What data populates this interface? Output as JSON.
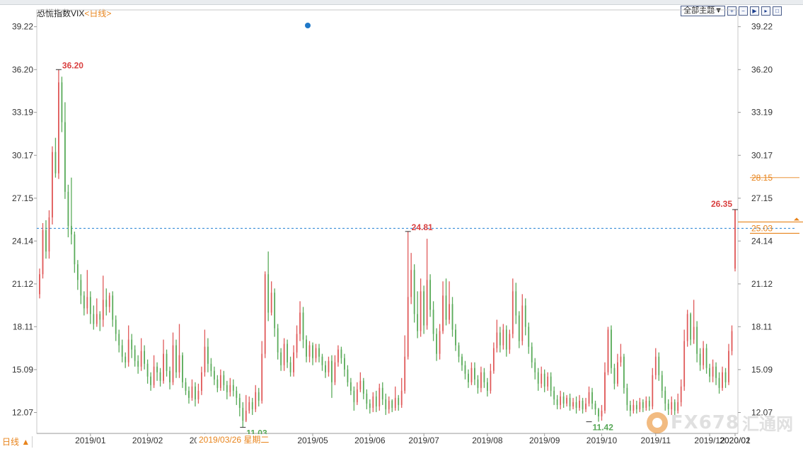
{
  "header": {
    "title": "恐慌指数VIX",
    "period_label": "<日线>",
    "topic_button": "全部主题▼",
    "control_icons": [
      "zoom-in-icon",
      "zoom-out-icon",
      "play-icon",
      "step-icon",
      "expand-icon"
    ]
  },
  "chart_data": {
    "type": "candlestick",
    "title": "恐慌指数VIX",
    "y_ticks": [
      "39.22",
      "36.20",
      "33.19",
      "30.17",
      "27.15",
      "24.14",
      "21.12",
      "18.11",
      "15.09",
      "12.07"
    ],
    "ylim": [
      10.6,
      40.2
    ],
    "x_ticks": [
      "2019/01",
      "2019/02",
      "2019/03",
      "2019/05",
      "2019/06",
      "2019/07",
      "2019/08",
      "2019/09",
      "2019/10",
      "2019/11",
      "2019/12",
      "2020/01",
      "2020/02"
    ],
    "annotations": [
      {
        "text": "36.20",
        "value": 36.2,
        "kind": "high"
      },
      {
        "text": "11.03",
        "value": 11.03,
        "kind": "low"
      },
      {
        "text": "24.81",
        "value": 24.81,
        "kind": "high"
      },
      {
        "text": "11.42",
        "value": 11.42,
        "kind": "low"
      },
      {
        "text": "26.35",
        "value": 26.35,
        "kind": "high"
      }
    ],
    "reference_line": 25.03,
    "right_labels": {
      "upper": "28.15",
      "current": "25.03"
    },
    "cursor_date": "2019/03/26 星期二",
    "bottom_left_label": "日线 ▲",
    "colors": {
      "up": "#e05a5a",
      "down": "#5aab5a",
      "reference": "#3b8fd9",
      "accent": "#e8841c",
      "annotation_high": "#d94040",
      "annotation_low": "#58a858"
    },
    "candles": [
      [
        20.4,
        21.8,
        20.1,
        22.2
      ],
      [
        21.8,
        24.9,
        21.5,
        25.4
      ],
      [
        24.9,
        23.4,
        22.9,
        25.6
      ],
      [
        23.4,
        25.8,
        22.9,
        26.3
      ],
      [
        25.8,
        30.4,
        25.3,
        30.8
      ],
      [
        30.4,
        28.9,
        28.6,
        31.4
      ],
      [
        28.9,
        35.3,
        28.5,
        36.2
      ],
      [
        35.3,
        32.5,
        31.8,
        35.7
      ],
      [
        32.5,
        27.6,
        27.1,
        33.9
      ],
      [
        27.6,
        25.2,
        24.4,
        28.1
      ],
      [
        25.2,
        24.6,
        23.9,
        28.6
      ],
      [
        24.6,
        22.5,
        21.9,
        24.8
      ],
      [
        22.5,
        21.4,
        20.7,
        22.8
      ],
      [
        21.4,
        20.3,
        19.7,
        21.8
      ],
      [
        20.3,
        19.4,
        18.9,
        20.6
      ],
      [
        19.4,
        20.2,
        19.0,
        22.1
      ],
      [
        20.2,
        19.0,
        18.3,
        20.6
      ],
      [
        19.0,
        18.3,
        17.9,
        19.6
      ],
      [
        18.3,
        19.0,
        18.1,
        20.1
      ],
      [
        19.0,
        18.6,
        17.8,
        19.2
      ],
      [
        18.6,
        20.0,
        18.1,
        21.7
      ],
      [
        20.0,
        19.5,
        18.9,
        20.8
      ],
      [
        19.5,
        20.3,
        19.1,
        20.5
      ],
      [
        20.3,
        18.6,
        18.1,
        20.6
      ],
      [
        18.6,
        17.6,
        17.1,
        18.9
      ],
      [
        17.6,
        16.8,
        16.3,
        17.9
      ],
      [
        16.8,
        16.0,
        15.6,
        17.2
      ],
      [
        16.0,
        15.6,
        15.2,
        16.3
      ],
      [
        15.6,
        17.2,
        15.3,
        18.2
      ],
      [
        17.2,
        16.5,
        15.9,
        17.6
      ],
      [
        16.5,
        15.7,
        15.3,
        16.8
      ],
      [
        15.7,
        15.3,
        14.8,
        16.1
      ],
      [
        15.3,
        16.4,
        15.0,
        17.3
      ],
      [
        16.4,
        15.5,
        15.1,
        16.8
      ],
      [
        15.5,
        14.6,
        14.1,
        15.8
      ],
      [
        14.6,
        14.0,
        13.6,
        14.9
      ],
      [
        14.0,
        15.3,
        13.8,
        16.1
      ],
      [
        15.3,
        14.9,
        14.3,
        15.6
      ],
      [
        14.9,
        14.3,
        13.9,
        15.2
      ],
      [
        14.3,
        16.2,
        14.1,
        17.2
      ],
      [
        16.2,
        15.0,
        14.6,
        16.5
      ],
      [
        15.0,
        14.2,
        13.7,
        15.3
      ],
      [
        14.2,
        16.8,
        14.0,
        17.7
      ],
      [
        16.8,
        14.9,
        14.5,
        17.2
      ],
      [
        14.9,
        16.1,
        14.5,
        18.3
      ],
      [
        16.1,
        14.2,
        13.8,
        16.3
      ],
      [
        14.2,
        13.6,
        13.3,
        14.5
      ],
      [
        13.6,
        13.1,
        12.7,
        13.9
      ],
      [
        13.1,
        13.9,
        12.9,
        14.4
      ],
      [
        13.9,
        13.0,
        12.5,
        14.2
      ],
      [
        13.0,
        13.6,
        12.7,
        14.1
      ],
      [
        13.6,
        14.9,
        13.3,
        15.3
      ],
      [
        14.9,
        16.7,
        14.6,
        17.9
      ],
      [
        16.7,
        15.5,
        14.9,
        17.3
      ],
      [
        15.5,
        15.0,
        14.6,
        15.9
      ],
      [
        15.0,
        14.4,
        14.0,
        15.3
      ],
      [
        14.4,
        13.8,
        13.5,
        14.7
      ],
      [
        13.8,
        14.7,
        13.6,
        15.1
      ],
      [
        14.7,
        14.0,
        13.6,
        15.0
      ],
      [
        14.0,
        13.5,
        13.0,
        14.3
      ],
      [
        13.5,
        14.0,
        13.2,
        14.5
      ],
      [
        14.0,
        13.6,
        13.2,
        14.4
      ],
      [
        13.6,
        13.1,
        12.6,
        13.9
      ],
      [
        13.1,
        12.4,
        11.8,
        13.4
      ],
      [
        12.4,
        11.5,
        11.03,
        12.8
      ],
      [
        11.5,
        12.2,
        11.4,
        13.3
      ],
      [
        12.2,
        12.8,
        12.0,
        13.2
      ],
      [
        12.8,
        12.3,
        11.9,
        13.1
      ],
      [
        12.3,
        13.5,
        12.1,
        14.0
      ],
      [
        13.5,
        12.9,
        12.5,
        13.8
      ],
      [
        12.9,
        16.2,
        12.7,
        17.1
      ],
      [
        16.2,
        21.8,
        15.9,
        22.0
      ],
      [
        21.8,
        19.1,
        18.5,
        23.4
      ],
      [
        19.1,
        20.5,
        18.9,
        21.3
      ],
      [
        20.5,
        18.0,
        17.4,
        20.8
      ],
      [
        18.0,
        16.3,
        15.8,
        18.3
      ],
      [
        16.3,
        15.4,
        15.0,
        16.6
      ],
      [
        15.4,
        16.9,
        15.0,
        17.3
      ],
      [
        16.9,
        15.6,
        15.2,
        17.2
      ],
      [
        15.6,
        14.9,
        14.6,
        16.0
      ],
      [
        14.9,
        16.3,
        14.6,
        16.8
      ],
      [
        16.3,
        17.6,
        15.9,
        18.2
      ],
      [
        17.6,
        19.1,
        17.1,
        19.9
      ],
      [
        19.1,
        17.2,
        16.6,
        19.5
      ],
      [
        17.2,
        16.0,
        15.6,
        17.5
      ],
      [
        16.0,
        16.8,
        15.6,
        17.1
      ],
      [
        16.8,
        15.9,
        15.4,
        17.0
      ],
      [
        15.9,
        16.6,
        15.6,
        16.9
      ],
      [
        16.6,
        16.0,
        15.6,
        16.9
      ],
      [
        16.0,
        15.4,
        15.0,
        16.2
      ],
      [
        15.4,
        14.9,
        14.5,
        15.7
      ],
      [
        14.9,
        15.7,
        14.6,
        16.0
      ],
      [
        15.7,
        14.2,
        13.1,
        16.1
      ],
      [
        14.2,
        15.6,
        14.0,
        16.1
      ],
      [
        15.6,
        16.5,
        15.3,
        16.8
      ],
      [
        16.5,
        15.9,
        15.5,
        16.7
      ],
      [
        15.9,
        15.1,
        14.6,
        16.2
      ],
      [
        15.1,
        14.2,
        13.9,
        15.4
      ],
      [
        14.2,
        13.6,
        13.3,
        14.5
      ],
      [
        13.6,
        12.8,
        12.2,
        13.9
      ],
      [
        12.8,
        13.7,
        12.6,
        14.2
      ],
      [
        13.7,
        14.3,
        13.5,
        14.9
      ],
      [
        14.3,
        13.4,
        13.0,
        14.5
      ],
      [
        13.4,
        12.7,
        12.3,
        13.7
      ],
      [
        12.7,
        12.4,
        12.0,
        13.0
      ],
      [
        12.4,
        13.2,
        12.1,
        13.5
      ],
      [
        13.2,
        12.5,
        12.1,
        13.6
      ],
      [
        12.5,
        13.8,
        12.2,
        14.1
      ],
      [
        13.8,
        13.0,
        12.6,
        14.2
      ],
      [
        13.0,
        12.3,
        11.9,
        13.4
      ],
      [
        12.3,
        12.9,
        12.0,
        13.2
      ],
      [
        12.9,
        12.4,
        12.1,
        13.0
      ],
      [
        12.4,
        13.1,
        12.2,
        13.9
      ],
      [
        13.1,
        12.6,
        12.2,
        13.3
      ],
      [
        12.6,
        13.6,
        12.4,
        14.5
      ],
      [
        13.6,
        16.0,
        13.4,
        17.5
      ],
      [
        16.0,
        20.2,
        15.8,
        24.81
      ],
      [
        20.2,
        22.1,
        19.7,
        23.3
      ],
      [
        22.1,
        19.0,
        18.4,
        22.5
      ],
      [
        19.0,
        17.8,
        17.3,
        20.6
      ],
      [
        17.8,
        20.6,
        17.4,
        21.5
      ],
      [
        20.6,
        18.2,
        17.6,
        21.0
      ],
      [
        18.2,
        21.4,
        17.9,
        24.3
      ],
      [
        21.4,
        19.3,
        18.8,
        21.8
      ],
      [
        19.3,
        17.6,
        17.1,
        19.9
      ],
      [
        17.6,
        16.2,
        15.7,
        18.0
      ],
      [
        16.2,
        17.8,
        15.8,
        18.3
      ],
      [
        17.8,
        20.3,
        17.6,
        21.3
      ],
      [
        20.3,
        18.6,
        18.2,
        21.5
      ],
      [
        18.6,
        19.7,
        18.3,
        21.3
      ],
      [
        19.7,
        17.9,
        17.4,
        20.2
      ],
      [
        17.9,
        16.8,
        16.4,
        18.3
      ],
      [
        16.8,
        16.0,
        15.6,
        17.0
      ],
      [
        16.0,
        15.4,
        15.0,
        16.2
      ],
      [
        15.4,
        14.8,
        14.4,
        15.7
      ],
      [
        14.8,
        14.2,
        13.8,
        15.1
      ],
      [
        14.2,
        15.2,
        14.0,
        15.6
      ],
      [
        15.2,
        14.4,
        14.0,
        15.6
      ],
      [
        14.4,
        13.8,
        13.4,
        14.7
      ],
      [
        13.8,
        14.9,
        13.5,
        15.3
      ],
      [
        14.9,
        14.2,
        13.8,
        15.2
      ],
      [
        14.2,
        13.6,
        13.2,
        14.5
      ],
      [
        13.6,
        15.0,
        13.4,
        15.5
      ],
      [
        15.0,
        16.6,
        14.8,
        17.0
      ],
      [
        16.6,
        17.7,
        16.3,
        18.6
      ],
      [
        17.7,
        16.8,
        16.3,
        18.1
      ],
      [
        16.8,
        17.9,
        16.5,
        18.3
      ],
      [
        17.9,
        16.5,
        16.0,
        18.2
      ],
      [
        16.5,
        17.6,
        16.2,
        17.9
      ],
      [
        17.6,
        20.6,
        17.3,
        21.5
      ],
      [
        20.6,
        18.9,
        18.3,
        21.2
      ],
      [
        18.9,
        17.1,
        16.6,
        19.2
      ],
      [
        17.1,
        19.6,
        16.8,
        20.4
      ],
      [
        19.6,
        18.1,
        17.5,
        20.1
      ],
      [
        18.1,
        16.7,
        16.2,
        18.4
      ],
      [
        16.7,
        15.6,
        15.2,
        17.0
      ],
      [
        15.6,
        14.9,
        14.4,
        15.9
      ],
      [
        14.9,
        14.1,
        13.6,
        15.2
      ],
      [
        14.1,
        14.8,
        13.8,
        15.3
      ],
      [
        14.8,
        13.9,
        13.5,
        15.1
      ],
      [
        13.9,
        14.6,
        13.6,
        14.9
      ],
      [
        14.6,
        13.6,
        13.2,
        14.9
      ],
      [
        13.6,
        13.0,
        12.6,
        13.9
      ],
      [
        13.0,
        12.6,
        12.3,
        13.3
      ],
      [
        12.6,
        13.2,
        12.3,
        13.6
      ],
      [
        13.2,
        12.7,
        12.4,
        13.5
      ],
      [
        12.7,
        13.1,
        12.5,
        13.3
      ],
      [
        13.1,
        12.5,
        12.2,
        13.4
      ],
      [
        12.5,
        12.8,
        12.3,
        13.1
      ],
      [
        12.8,
        12.4,
        12.0,
        13.2
      ],
      [
        12.4,
        12.9,
        12.2,
        13.3
      ],
      [
        12.9,
        12.3,
        12.0,
        13.1
      ],
      [
        12.3,
        12.7,
        12.1,
        13.1
      ],
      [
        12.7,
        13.5,
        12.5,
        13.9
      ],
      [
        13.5,
        12.7,
        12.3,
        13.8
      ],
      [
        12.7,
        12.3,
        11.9,
        12.9
      ],
      [
        12.3,
        11.8,
        11.42,
        12.4
      ],
      [
        11.8,
        12.2,
        11.5,
        12.6
      ],
      [
        12.2,
        14.9,
        12.0,
        15.6
      ],
      [
        14.9,
        17.9,
        14.7,
        18.1
      ],
      [
        17.9,
        15.2,
        14.8,
        18.2
      ],
      [
        15.2,
        14.1,
        13.7,
        15.5
      ],
      [
        14.1,
        15.6,
        13.9,
        16.2
      ],
      [
        15.6,
        16.0,
        15.3,
        16.9
      ],
      [
        16.0,
        13.8,
        13.4,
        16.2
      ],
      [
        13.8,
        12.6,
        12.2,
        14.1
      ],
      [
        12.6,
        12.2,
        11.8,
        12.9
      ],
      [
        12.2,
        12.6,
        12.0,
        13.0
      ],
      [
        12.6,
        12.3,
        12.0,
        12.9
      ],
      [
        12.3,
        12.8,
        12.1,
        13.1
      ],
      [
        12.8,
        12.4,
        12.1,
        13.0
      ],
      [
        12.4,
        12.9,
        12.2,
        13.2
      ],
      [
        12.9,
        12.5,
        12.2,
        13.2
      ],
      [
        12.5,
        14.7,
        12.3,
        15.2
      ],
      [
        14.7,
        16.0,
        14.4,
        16.6
      ],
      [
        16.0,
        14.7,
        14.3,
        16.3
      ],
      [
        14.7,
        13.6,
        13.1,
        15.0
      ],
      [
        13.6,
        12.7,
        12.2,
        13.9
      ],
      [
        12.7,
        12.3,
        11.9,
        13.0
      ],
      [
        12.3,
        12.8,
        11.9,
        13.2
      ],
      [
        12.8,
        12.2,
        11.9,
        13.0
      ],
      [
        12.2,
        12.8,
        12.0,
        13.4
      ],
      [
        12.8,
        13.9,
        12.5,
        14.4
      ],
      [
        13.9,
        17.1,
        13.6,
        17.9
      ],
      [
        17.1,
        19.0,
        16.7,
        19.3
      ],
      [
        19.0,
        17.2,
        16.8,
        19.1
      ],
      [
        17.2,
        18.1,
        16.9,
        20.0
      ],
      [
        18.1,
        16.2,
        15.6,
        18.5
      ],
      [
        16.2,
        15.4,
        15.0,
        16.6
      ],
      [
        15.4,
        16.6,
        15.1,
        17.1
      ],
      [
        16.6,
        15.2,
        14.8,
        16.9
      ],
      [
        15.2,
        14.6,
        14.2,
        15.5
      ],
      [
        14.6,
        15.3,
        14.2,
        15.8
      ],
      [
        15.3,
        14.5,
        14.0,
        15.6
      ],
      [
        14.5,
        13.8,
        13.4,
        14.9
      ],
      [
        13.8,
        14.9,
        13.6,
        15.3
      ],
      [
        14.9,
        14.2,
        13.8,
        15.2
      ],
      [
        14.2,
        16.4,
        14.0,
        16.9
      ],
      [
        16.4,
        17.8,
        16.1,
        18.2
      ],
      [
        22.2,
        26.35,
        22.0,
        26.35
      ]
    ]
  }
}
